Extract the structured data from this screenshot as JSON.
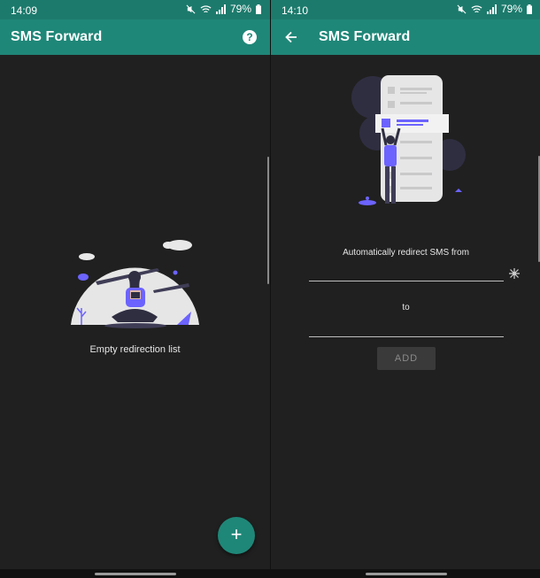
{
  "left": {
    "status": {
      "time": "14:09",
      "battery": "79%"
    },
    "appbar": {
      "title": "SMS Forward",
      "help_glyph": "?"
    },
    "empty_text": "Empty redirection list",
    "fab_glyph": "+"
  },
  "right": {
    "status": {
      "time": "14:10",
      "battery": "79%"
    },
    "appbar": {
      "title": "SMS Forward"
    },
    "from_label": "Automatically redirect SMS from",
    "from_value": "",
    "to_label": "to",
    "to_value": "",
    "add_label": "ADD"
  },
  "colors": {
    "primary": "#1f8778",
    "status": "#1c7a6c",
    "background": "#202020",
    "accent_illustration": "#6c63ff"
  },
  "icons": [
    "mute-icon",
    "wifi-icon",
    "signal-icon",
    "battery-icon",
    "help-icon",
    "back-arrow-icon",
    "contacts-icon",
    "plus-icon"
  ]
}
